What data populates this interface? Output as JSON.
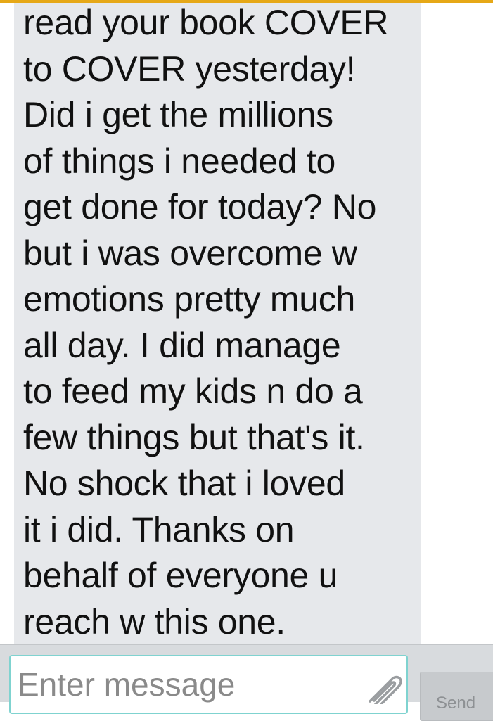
{
  "conversation": {
    "message_lines": [
      "read your book COVER",
      "to COVER yesterday!",
      "Did i get the millions",
      "of things i needed to",
      "get done for today? No",
      "but i was overcome w",
      "emotions pretty much",
      "all day. I did manage",
      "to feed my kids n do a",
      "few things but that's it.",
      "No shock that i loved",
      "it i did. Thanks on",
      "behalf of everyone u",
      "reach w this one."
    ]
  },
  "composer": {
    "input_placeholder": "Enter message",
    "input_value": "",
    "attach_icon": "paperclip-icon",
    "send_label": "Send"
  },
  "colors": {
    "accent_top": "#e6a817",
    "bubble_background": "#e6e8eb",
    "input_border": "#7fd3d0"
  }
}
